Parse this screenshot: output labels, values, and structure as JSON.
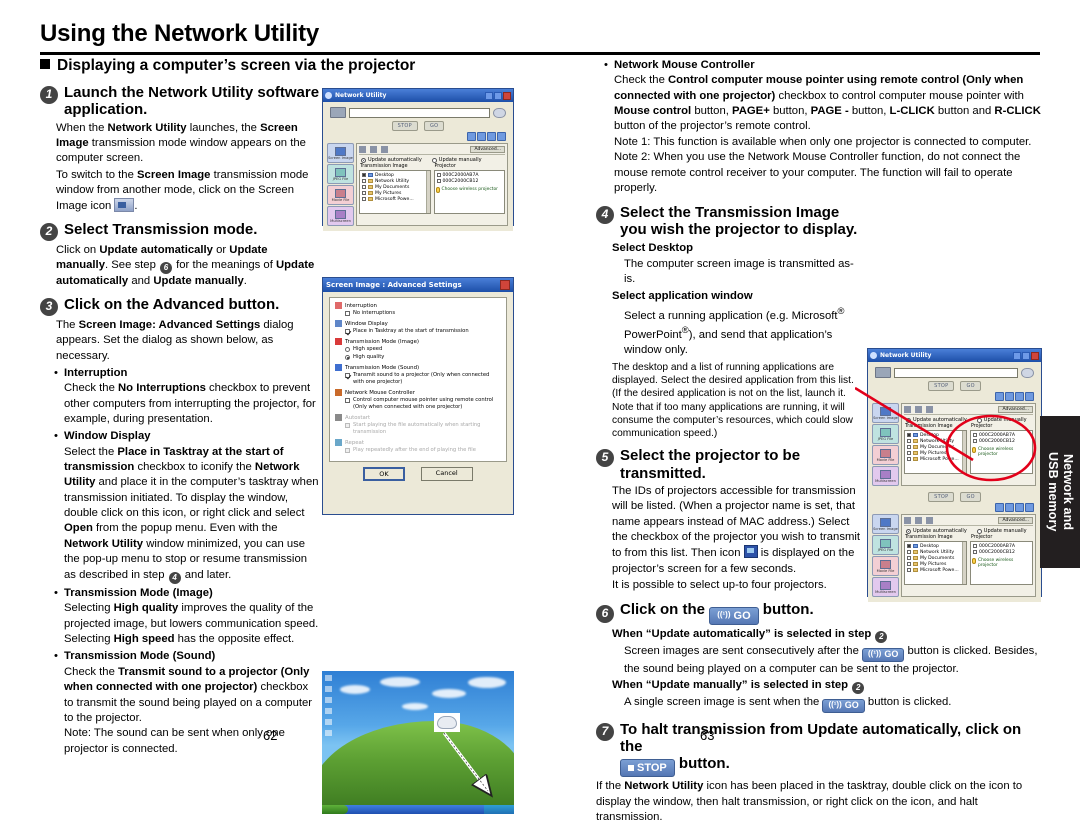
{
  "document": {
    "title": "Using the Network Utility",
    "section_heading": "Displaying a computer’s screen via the projector",
    "page_left": "62",
    "page_right": "63",
    "thumb_tab": "Network and\nUSB memory"
  },
  "colors": {
    "accent_red": "#e2001a",
    "title_bar_blue": "#1d4fa8",
    "tab_black": "#231f20",
    "button_blue": "#5577b4"
  },
  "left_column": {
    "step1": {
      "number": "1",
      "heading": "Launch the Network Utility software application.",
      "p1_a": "When the ",
      "p1_b": "Network Utility",
      "p1_c": " launches, the ",
      "p1_d": "Screen Image",
      "p1_e": " transmission mode window appears on the computer screen.",
      "p2_a": "To switch to the ",
      "p2_b": "Screen Image",
      "p2_c": " transmission mode window from another mode, click on the Screen Image icon",
      "p2_icon": "screen-image-icon"
    },
    "step2": {
      "number": "2",
      "heading": "Select Transmission mode.",
      "p1_a": "Click on ",
      "p1_b": "Update automatically",
      "p1_c": " or ",
      "p1_d": "Update manually",
      "p1_e": ". See step ",
      "p1_step_ref": "6",
      "p1_f": " for the meanings of ",
      "p1_g": "Update automatically",
      "p1_h": " and ",
      "p1_i": "Update manually",
      "p1_j": "."
    },
    "step3": {
      "number": "3",
      "heading": "Click on the Advanced button.",
      "p1_a": "The ",
      "p1_b": "Screen Image: Advanced Settings",
      "p1_c": " dialog appears. Set the dialog as shown below, as necessary.",
      "bullets": [
        {
          "title": "Interruption",
          "lines": [
            {
              "a": "Check the ",
              "b": "No Interruptions",
              "c": " checkbox to prevent other computers from interrupting the projector, for example, during presentation."
            }
          ]
        },
        {
          "title": "Window Display",
          "lines": [
            {
              "a": "Select the ",
              "b": "Place in Tasktray at the start of transmission",
              "c": " checkbox to iconify the "
            },
            {
              "a": "",
              "b": "Network Utility",
              "c": " and place it in the computer’s tasktray when transmission initiated."
            },
            {
              "a": "To display the window, double click on this icon, or right click and select ",
              "b": "Open",
              "c": " from the popup menu. Even with the "
            },
            {
              "a": "",
              "b": "Network Utility",
              "c": " window minimized, you can use the pop-up menu to stop or resume transmission as described in step "
            },
            {
              "a": "",
              "b": "",
              "c": " and later.",
              "step_ref": "4"
            }
          ]
        },
        {
          "title": "Transmission Mode (Image)",
          "lines": [
            {
              "a": "Selecting ",
              "b": "High quality",
              "c": " improves the quality of the projected image, but lowers communication speed. Selecting "
            },
            {
              "a": "",
              "b": "High speed",
              "c": " has the opposite effect."
            }
          ]
        },
        {
          "title": "Transmission Mode (Sound)",
          "lines": [
            {
              "a": "Check the ",
              "b": "Transmit sound to a projector (Only when connected with one projector)",
              "c": " checkbox to transmit the sound being played on a computer to the projector."
            },
            {
              "a": "Note: The sound can be sent when only one projector is connected.",
              "b": "",
              "c": ""
            }
          ]
        }
      ]
    }
  },
  "right_column": {
    "bullet_mouse": {
      "title": "Network Mouse Controller",
      "l1_a": "Check the ",
      "l1_b": "Control computer mouse pointer using remote control (Only when connected with one projector)",
      "l1_c": " checkbox to control computer mouse pointer with ",
      "l1_d": "Mouse control",
      "l1_e": " button, ",
      "l1_f": "PAGE+",
      "l1_g": " button, ",
      "l1_h": "PAGE -",
      "l1_i": " button, ",
      "l1_j": "L-CLICK",
      "l1_k": " button and ",
      "l1_l": "R-CLICK",
      "l1_m": " button of the projector’s remote control.",
      "note1": "Note 1: This function is available when only one projector is connected to computer.",
      "note2": "Note 2: When you use the Network Mouse Controller function, do not connect the mouse remote control receiver to your computer. The function will fail to operate properly."
    },
    "step4": {
      "number": "4",
      "heading": "Select the Transmission Image you wish the projector to display.",
      "sub1_title": "Select Desktop",
      "sub1_text": "The computer screen image is transmitted as-is.",
      "sub2_title": "Select application window",
      "sub2_text_a": "Select a running application (e.g. Microsoft",
      "sub2_text_b": "®",
      "sub2_text_c": " PowerPoint",
      "sub2_text_d": "®",
      "sub2_text_e": "), and send that application’s window only.",
      "small": "The desktop and a list of running applications are displayed. Select the desired application from this list. (If the desired application is not on the list, launch it. Note that if too many applications are running, it will consume the computer’s resources, which could slow communication speed.)"
    },
    "step5": {
      "number": "5",
      "heading": "Select the projector to be transmitted.",
      "p_a": "The IDs of projectors accessible for transmission will be listed. (When a projector name is set, that name appears instead of MAC address.) Select the checkbox of the projector you wish to transmit to from this list. Then icon ",
      "p_icon": "projector-transmit-icon",
      "p_b": " is displayed on the projector’s screen for a few seconds.",
      "p_c": "It is possible to select up-to four projectors."
    },
    "step6": {
      "number": "6",
      "heading_a": "Click on the ",
      "heading_btn": "GO",
      "heading_b": " button.",
      "auto_title_a": "When “Update automatically” is selected in step ",
      "auto_title_ref": "2",
      "auto_text_a": "Screen images are sent consecutively after the ",
      "auto_btn": "GO",
      "auto_text_b": " button is clicked. Besides, the sound being played on a computer can be sent to the projector.",
      "manual_title_a": "When “Update manually” is selected in step ",
      "manual_title_ref": "2",
      "manual_text_a": "A single screen image is sent when the ",
      "manual_btn": "GO",
      "manual_text_b": " button is clicked."
    },
    "step7": {
      "number": "7",
      "heading_a": "To halt transmission from Update automatically, click on the ",
      "heading_btn": "STOP",
      "heading_b": " button.",
      "p_a": "If the ",
      "p_b": "Network Utility",
      "p_c": " icon has been placed in the tasktray, double click on the icon to display the window, then halt transmission, or right click on the icon, and halt transmission."
    }
  },
  "figures": {
    "network_utility_window": {
      "title": "Network Utility",
      "buttons": {
        "stop": "STOP",
        "go": "GO",
        "advanced": "Advanced..."
      },
      "radios": {
        "auto": "Update automatically",
        "manual": "Update manually"
      },
      "list_headers": {
        "transmission": "Transmission Image",
        "projector": "Projector"
      },
      "transmission_items": [
        "Desktop",
        "Network Utility",
        "My Documents",
        "My Pictures",
        "Microsoft Powe..."
      ],
      "projector_items": [
        "000C2000AB7A",
        "000C2000CB12"
      ],
      "wireless_note": "Choose wireless projector",
      "side_tabs": [
        "Screen Image",
        "JPEG File",
        "Movie File",
        "Multiscreen"
      ]
    },
    "advanced_dialog": {
      "title": "Screen Image : Advanced Settings",
      "groups": [
        {
          "name": "Interruption",
          "items": [
            {
              "label": "No interruptions",
              "checked": false,
              "type": "check"
            }
          ]
        },
        {
          "name": "Window Display",
          "items": [
            {
              "label": "Place in Tasktray at the start of transmission",
              "checked": true,
              "type": "check"
            }
          ]
        },
        {
          "name": "Transmission Mode (Image)",
          "items": [
            {
              "label": "High speed",
              "checked": false,
              "type": "radio"
            },
            {
              "label": "High quality",
              "checked": true,
              "type": "radio"
            }
          ]
        },
        {
          "name": "Transmission Mode (Sound)",
          "items": [
            {
              "label": "Transmit sound to a projector (Only when connected with one projector)",
              "checked": true,
              "type": "check"
            }
          ]
        },
        {
          "name": "Network Mouse Controller",
          "items": [
            {
              "label": "Control computer mouse pointer using remote control (Only when connected with one projector)",
              "checked": false,
              "type": "check"
            }
          ]
        },
        {
          "name": "Autostart",
          "disabled": true,
          "items": [
            {
              "label": "Start playing the file automatically when starting transmission",
              "checked": false,
              "type": "check"
            }
          ]
        },
        {
          "name": "Repeat",
          "disabled": true,
          "items": [
            {
              "label": "Play repeatedly after the end of playing the file",
              "checked": false,
              "type": "check"
            }
          ]
        }
      ],
      "ok": "OK",
      "cancel": "Cancel"
    },
    "desktop_figure": {
      "caption": "Windows desktop showing tasktray icon"
    }
  }
}
